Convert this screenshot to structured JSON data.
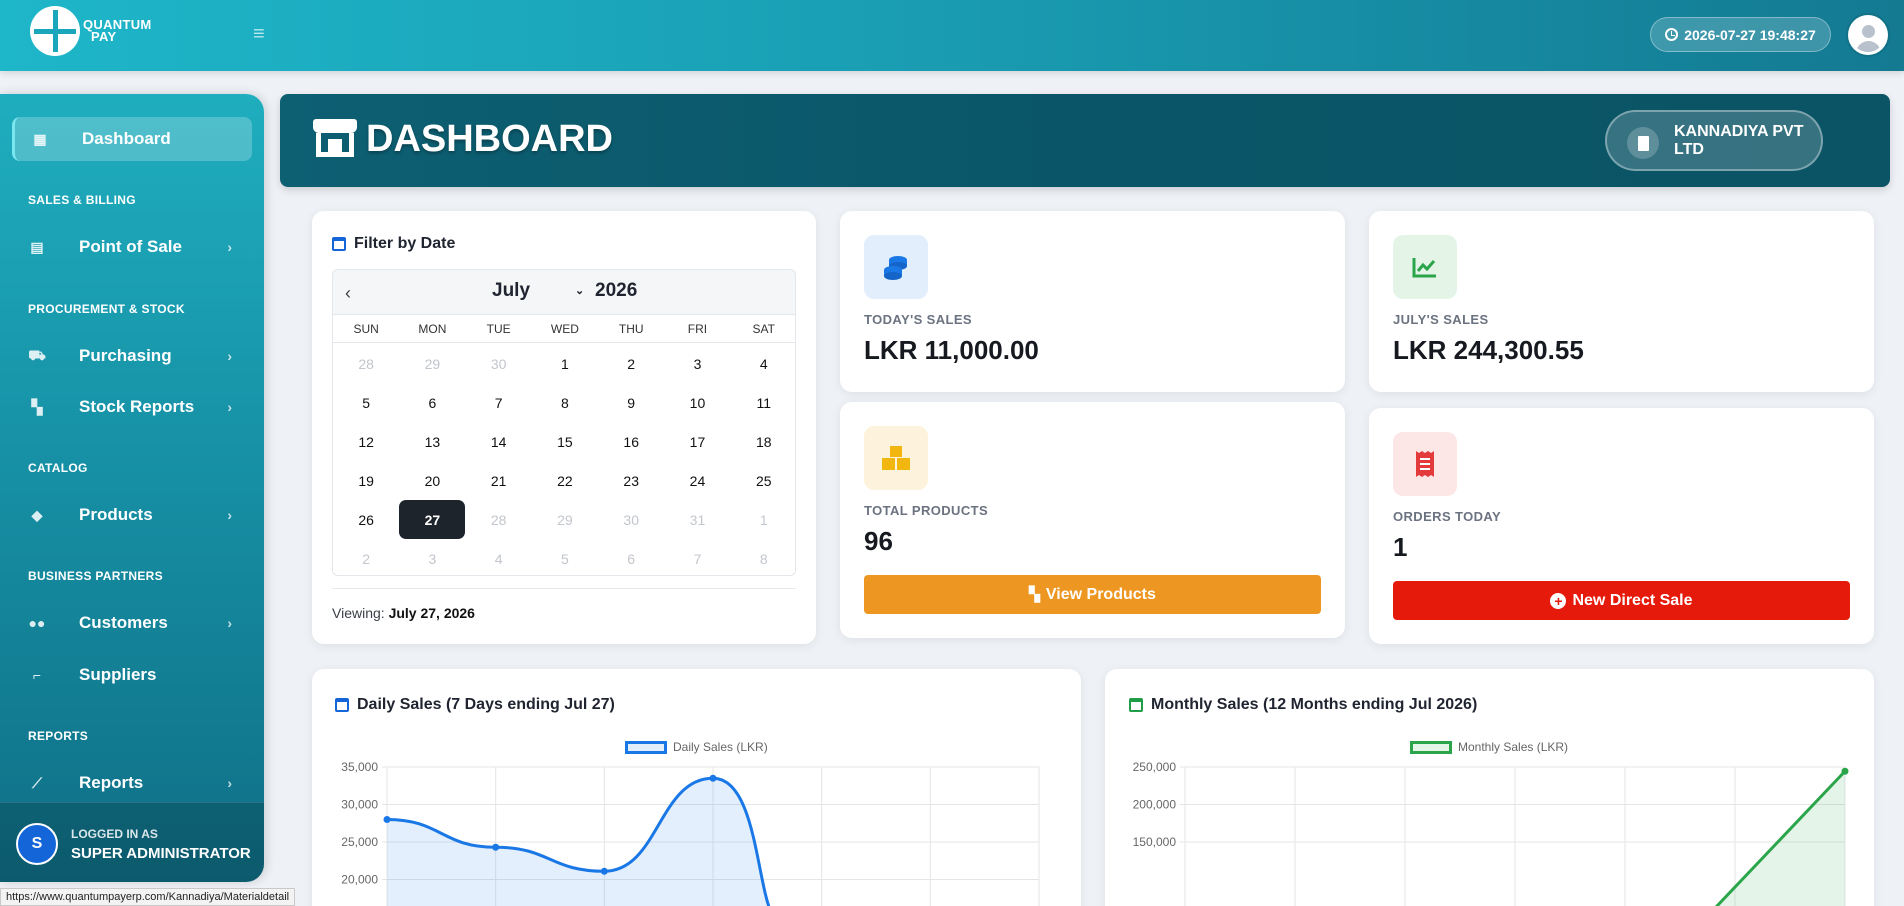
{
  "brand": {
    "line1": "QUANTUM",
    "line2": "PAY"
  },
  "topbar": {
    "datetime": "2026-07-27 19:48:27"
  },
  "sidebar": {
    "dashboard": "Dashboard",
    "sec_sales": "SALES & BILLING",
    "point_of_sale": "Point of Sale",
    "sec_procurement": "PROCUREMENT & STOCK",
    "purchasing": "Purchasing",
    "stock_reports": "Stock Reports",
    "sec_catalog": "CATALOG",
    "products": "Products",
    "sec_partners": "BUSINESS PARTNERS",
    "customers": "Customers",
    "suppliers": "Suppliers",
    "sec_reports": "REPORTS",
    "reports": "Reports",
    "chevron": "›"
  },
  "user": {
    "initial": "S",
    "label": "LOGGED IN AS",
    "name": "SUPER ADMINISTRATOR"
  },
  "status_url": "https://www.quantumpayerp.com/Kannadiya/Materialdetail",
  "header": {
    "title": "DASHBOARD",
    "company": "KANNADIYA PVT LTD"
  },
  "filter": {
    "title": "Filter by Date",
    "month": "July",
    "year": "2026",
    "dow": [
      "SUN",
      "MON",
      "TUE",
      "WED",
      "THU",
      "FRI",
      "SAT"
    ],
    "days": [
      [
        "28",
        "m"
      ],
      [
        "29",
        "m"
      ],
      [
        "30",
        "m"
      ],
      [
        "1",
        ""
      ],
      [
        "2",
        ""
      ],
      [
        "3",
        ""
      ],
      [
        "4",
        ""
      ],
      [
        "5",
        ""
      ],
      [
        "6",
        ""
      ],
      [
        "7",
        ""
      ],
      [
        "8",
        ""
      ],
      [
        "9",
        ""
      ],
      [
        "10",
        ""
      ],
      [
        "11",
        ""
      ],
      [
        "12",
        ""
      ],
      [
        "13",
        ""
      ],
      [
        "14",
        ""
      ],
      [
        "15",
        ""
      ],
      [
        "16",
        ""
      ],
      [
        "17",
        ""
      ],
      [
        "18",
        ""
      ],
      [
        "19",
        ""
      ],
      [
        "20",
        ""
      ],
      [
        "21",
        ""
      ],
      [
        "22",
        ""
      ],
      [
        "23",
        ""
      ],
      [
        "24",
        ""
      ],
      [
        "25",
        ""
      ],
      [
        "26",
        ""
      ],
      [
        "27",
        "s"
      ],
      [
        "28",
        "m"
      ],
      [
        "29",
        "m"
      ],
      [
        "30",
        "m"
      ],
      [
        "31",
        "m"
      ],
      [
        "1",
        "m"
      ],
      [
        "2",
        "m"
      ],
      [
        "3",
        "m"
      ],
      [
        "4",
        "m"
      ],
      [
        "5",
        "m"
      ],
      [
        "6",
        "m"
      ],
      [
        "7",
        "m"
      ],
      [
        "8",
        "m"
      ]
    ],
    "viewing_label": "Viewing:",
    "viewing_date": "July 27, 2026"
  },
  "stats": {
    "today_label": "TODAY'S SALES",
    "today_value": "LKR 11,000.00",
    "month_label": "JULY'S SALES",
    "month_value": "LKR 244,300.55",
    "products_label": "TOTAL PRODUCTS",
    "products_value": "96",
    "products_button": "View Products",
    "orders_label": "ORDERS TODAY",
    "orders_value": "1",
    "orders_button": "New Direct Sale"
  },
  "colors": {
    "accent_teal": "#1aa6bb",
    "banner": "#0b5a6c",
    "orange": "#ed9722",
    "red": "#e61a0a",
    "blue": "#1a78e6",
    "green": "#2aa54a"
  },
  "chart_data": [
    {
      "type": "area",
      "title": "Daily Sales (7 Days ending Jul 27)",
      "series": [
        {
          "name": "Daily Sales (LKR)",
          "values": [
            28000,
            24300,
            21100,
            33500
          ]
        }
      ],
      "y_ticks": [
        "35,000",
        "30,000",
        "25,000",
        "20,000"
      ],
      "ylim": [
        20000,
        35000
      ],
      "grid": true,
      "legend": "top-center",
      "color": "#1a78e6"
    },
    {
      "type": "area",
      "title": "Monthly Sales (12 Months ending Jul 2026)",
      "series": [
        {
          "name": "Monthly Sales (LKR)",
          "values": [
            244300
          ]
        }
      ],
      "y_ticks": [
        "250,000",
        "200,000",
        "150,000"
      ],
      "ylim": [
        150000,
        250000
      ],
      "grid": true,
      "legend": "top-center",
      "color": "#2aa54a"
    }
  ]
}
